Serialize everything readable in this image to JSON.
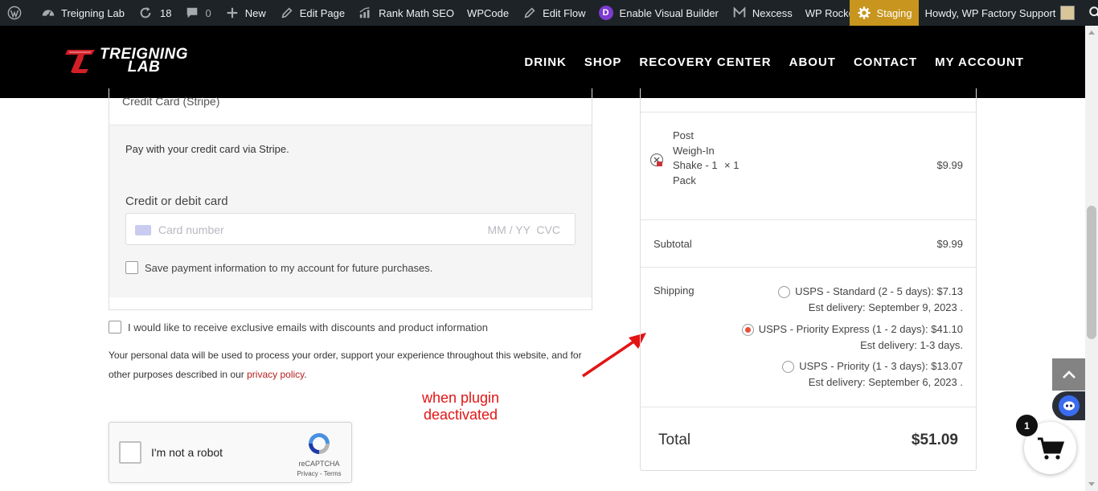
{
  "adminbar": {
    "site_name": "Treigning Lab",
    "updates_count": "18",
    "comments_count": "0",
    "new_label": "New",
    "edit_page_label": "Edit Page",
    "rank_math_label": "Rank Math SEO",
    "wpcode_label": "WPCode",
    "edit_flow_label": "Edit Flow",
    "visual_builder_label": "Enable Visual Builder",
    "nexcess_label": "Nexcess",
    "wp_rocket_label": "WP Rocket",
    "staging_label": "Staging",
    "howdy_label": "Howdy, WP Factory Support",
    "divi_letter": "D"
  },
  "header": {
    "logo_line1": "TREIGNING",
    "logo_line2": "LAB",
    "nav": [
      "DRINK",
      "SHOP",
      "RECOVERY CENTER",
      "ABOUT",
      "CONTACT",
      "MY ACCOUNT"
    ]
  },
  "payment": {
    "method_title": "Credit Card (Stripe)",
    "description": "Pay with your credit card via Stripe.",
    "card_label": "Credit or debit card",
    "card_placeholder": "Card number",
    "expiry_cvc_placeholder": "MM / YY  CVC",
    "save_label": "Save payment information to my account for future purchases."
  },
  "checkout": {
    "newsletter_label": "I would like to receive exclusive emails with discounts and product information",
    "privacy_text": "Your personal data will be used to process your order, support your experience throughout this website, and for other purposes described in our",
    "privacy_link": "privacy policy",
    "privacy_end": "."
  },
  "annotation": {
    "line1": "when plugin",
    "line2": "deactivated",
    "color": "#e31414"
  },
  "recaptcha": {
    "label": "I'm not a robot",
    "brand": "reCAPTCHA",
    "privacy": "Privacy",
    "separator": " - ",
    "terms": "Terms"
  },
  "order": {
    "product_name": "Post Weigh-In Shake - 1 Pack",
    "product_qty": "× 1",
    "product_price": "$9.99",
    "subtotal_label": "Subtotal",
    "subtotal_value": "$9.99",
    "shipping_label": "Shipping",
    "shipping_options": [
      {
        "label": "USPS - Standard (2 - 5 days): $7.13",
        "delivery": "Est delivery: September 9, 2023 .",
        "selected": false
      },
      {
        "label": "USPS - Priority Express (1 - 2 days): $41.10",
        "delivery": "Est delivery: 1-3 days.",
        "selected": true
      },
      {
        "label": "USPS - Priority (1 - 3 days): $13.07",
        "delivery": "Est delivery: September 6, 2023 .",
        "selected": false
      }
    ],
    "total_label": "Total",
    "total_value": "$51.09"
  },
  "cart": {
    "count": "1"
  },
  "colors": {
    "adminbar_bg": "#1d2327",
    "staging_bg": "#c8961e",
    "accent_red": "#b51f1f",
    "radio_selected": "#e8503a"
  }
}
